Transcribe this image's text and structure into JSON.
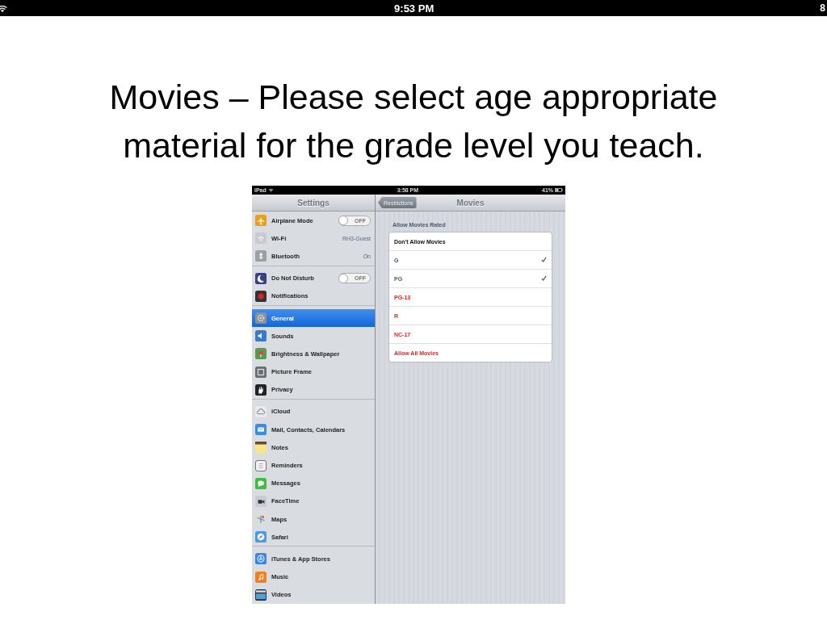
{
  "status_bar": {
    "time": "9:53 PM",
    "edge_text": "8"
  },
  "slide": {
    "title": "Movies – Please select age appropriate material for the grade level you teach."
  },
  "screenshot": {
    "status_bar": {
      "carrier": "iPad",
      "time": "3:58 PM",
      "battery": "41%"
    },
    "sidebar": {
      "title": "Settings",
      "groups": [
        {
          "items": [
            {
              "label": "Airplane Mode",
              "kind": "toggle",
              "on": false,
              "toggle_label": "OFF",
              "selected": false
            },
            {
              "label": "Wi-Fi",
              "kind": "value",
              "value": "RH3-Guest",
              "selected": false
            },
            {
              "label": "Bluetooth",
              "kind": "value",
              "value": "On",
              "selected": false
            }
          ]
        },
        {
          "items": [
            {
              "label": "Do Not Disturb",
              "kind": "toggle",
              "on": false,
              "toggle_label": "OFF",
              "selected": false
            },
            {
              "label": "Notifications",
              "kind": "link",
              "selected": false
            }
          ]
        },
        {
          "items": [
            {
              "label": "General",
              "kind": "link",
              "selected": true
            },
            {
              "label": "Sounds",
              "kind": "link",
              "selected": false
            },
            {
              "label": "Brightness & Wallpaper",
              "kind": "link",
              "selected": false
            },
            {
              "label": "Picture Frame",
              "kind": "link",
              "selected": false
            },
            {
              "label": "Privacy",
              "kind": "link",
              "selected": false
            }
          ]
        },
        {
          "items": [
            {
              "label": "iCloud",
              "kind": "link",
              "selected": false
            },
            {
              "label": "Mail, Contacts, Calendars",
              "kind": "link",
              "selected": false
            },
            {
              "label": "Notes",
              "kind": "link",
              "selected": false
            },
            {
              "label": "Reminders",
              "kind": "link",
              "selected": false
            },
            {
              "label": "Messages",
              "kind": "link",
              "selected": false
            },
            {
              "label": "FaceTime",
              "kind": "link",
              "selected": false
            },
            {
              "label": "Maps",
              "kind": "link",
              "selected": false
            },
            {
              "label": "Safari",
              "kind": "link",
              "selected": false
            }
          ]
        },
        {
          "items": [
            {
              "label": "iTunes & App Stores",
              "kind": "link",
              "selected": false
            },
            {
              "label": "Music",
              "kind": "link",
              "selected": false
            },
            {
              "label": "Videos",
              "kind": "link",
              "selected": false
            }
          ]
        }
      ]
    },
    "detail": {
      "back_button": "Restrictions",
      "title": "Movies",
      "section_header": "Allow Movies Rated",
      "options": [
        {
          "label": "Don't Allow Movies",
          "kind": "none",
          "checked": false
        },
        {
          "label": "G",
          "kind": "rating",
          "checked": true
        },
        {
          "label": "PG",
          "kind": "rating",
          "checked": true
        },
        {
          "label": "PG-13",
          "kind": "rating",
          "checked": false
        },
        {
          "label": "R",
          "kind": "rating",
          "checked": false
        },
        {
          "label": "NC-17",
          "kind": "rating",
          "checked": false
        },
        {
          "label": "Allow All Movies",
          "kind": "all",
          "checked": false
        }
      ]
    }
  }
}
